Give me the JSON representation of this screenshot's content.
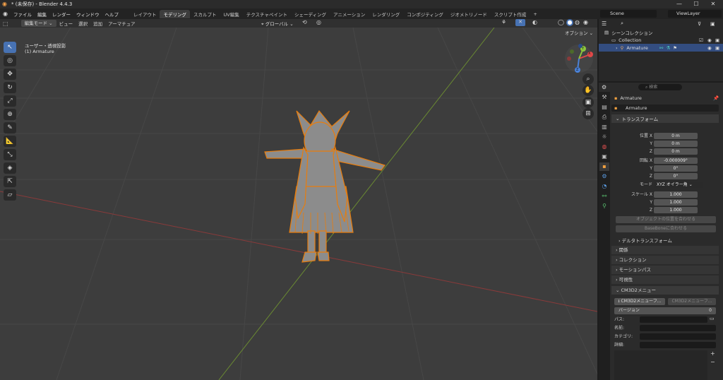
{
  "app": {
    "title": "* (未保存) - Blender 4.4.3"
  },
  "menu": {
    "items": [
      "ファイル",
      "編集",
      "レンダー",
      "ウィンドウ",
      "ヘルプ"
    ],
    "tabs": [
      "レイアウト",
      "モデリング",
      "スカルプト",
      "UV編集",
      "テクスチャペイント",
      "シェーディング",
      "アニメーション",
      "レンダリング",
      "コンポジティング",
      "ジオメトリノード",
      "スクリプト作成",
      "+"
    ],
    "active_tab": 1,
    "scene": "Scene",
    "view_layer": "ViewLayer"
  },
  "viewport_header": {
    "mode": "編集モード",
    "menus": [
      "ビュー",
      "選択",
      "追加",
      "アーマチュア"
    ],
    "orientation": "グローバル",
    "options": "オプション"
  },
  "viewport": {
    "view_name": "ユーザー・透視投影",
    "object_line": "(1) Armature",
    "axis_x": "X",
    "axis_y": "Y",
    "axis_z": "Z"
  },
  "outliner": {
    "title": "シーンコレクション",
    "collection": "Collection",
    "object": "Armature"
  },
  "properties": {
    "search_placeholder": "検索",
    "object_name": "Armature",
    "data_name": "Armature",
    "transform": {
      "title": "トランスフォーム",
      "location_label": "位置 X",
      "location": [
        "0 m",
        "0 m",
        "0 m"
      ],
      "rotation_label": "回転 X",
      "rotation": [
        "-0.000009°",
        "0°",
        "0°"
      ],
      "mode_label": "モード",
      "mode": "XYZ オイラー角",
      "scale_label": "スケール X",
      "scale": [
        "1.000",
        "1.000",
        "1.000"
      ],
      "y": "Y",
      "z": "Z",
      "btn_align_object": "オブジェクトの位置を合わせる",
      "btn_align_basebone": "BaseBoneに合わせる",
      "delta": "デルタトランスフォーム"
    },
    "panels": [
      "関係",
      "コレクション",
      "モーションパス",
      "可視性"
    ],
    "cm3d2": {
      "title": "CM3D2メニュー",
      "btn1": "CM3D2メニューフ...",
      "btn2": "CM3D2メニューフ...",
      "version_label": "バージョン",
      "version_value": "0",
      "path_label": "パス:",
      "name_label": "名前:",
      "category_label": "カテゴリ:",
      "detail_label": "詳細:"
    }
  },
  "colors": {
    "accent": "#4772b3",
    "selection": "#e87d0d"
  }
}
